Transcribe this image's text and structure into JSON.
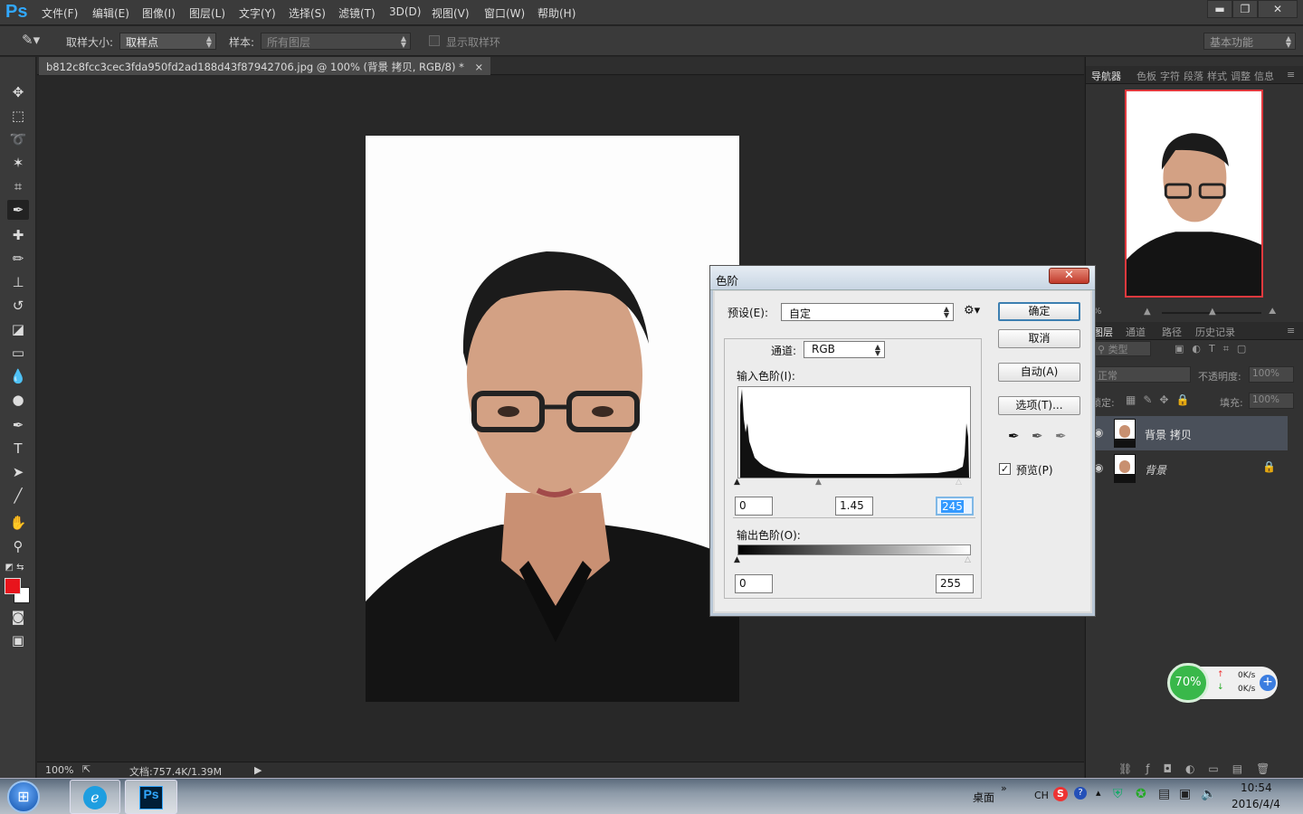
{
  "app": {
    "logo": "Ps"
  },
  "menu": [
    "文件(F)",
    "编辑(E)",
    "图像(I)",
    "图层(L)",
    "文字(Y)",
    "选择(S)",
    "滤镜(T)",
    "3D(D)",
    "视图(V)",
    "窗口(W)",
    "帮助(H)"
  ],
  "window_controls": {
    "minimize": "▬",
    "restore": "❐",
    "close": "✕"
  },
  "options_bar": {
    "sample_size_label": "取样大小:",
    "sample_size_value": "取样点",
    "sample_label": "样本:",
    "sample_value": "所有图层",
    "show_ring_label": "显示取样环",
    "workspace": "基本功能"
  },
  "document": {
    "tab_title": "b812c8fcc3cec3fda950fd2ad188d43f87942706.jpg @ 100% (背景 拷贝, RGB/8) *",
    "tab_close": "×"
  },
  "status": {
    "zoom": "100%",
    "doc_size": "文档:757.4K/1.39M"
  },
  "panels": {
    "top_tabs": [
      "导航器",
      "色板",
      "字符",
      "段落",
      "样式",
      "调整",
      "信息"
    ],
    "nav_zoom": "%",
    "layer_tabs": [
      "图层",
      "通道",
      "路径",
      "历史记录"
    ],
    "filter_type": "类型",
    "blend_mode": "正常",
    "opacity_label": "不透明度:",
    "opacity_value": "100%",
    "lock_label": "锁定:",
    "fill_label": "填充:",
    "fill_value": "100%",
    "layers": [
      {
        "name": "背景 拷贝",
        "selected": true
      },
      {
        "name": "背景",
        "locked": true
      }
    ]
  },
  "levels_dialog": {
    "title": "色阶",
    "close": "✕",
    "preset_label": "预设(E):",
    "preset_value": "自定",
    "channel_label": "通道:",
    "channel_value": "RGB",
    "input_levels_label": "输入色阶(I):",
    "input_black": "0",
    "input_gamma": "1.45",
    "input_white": "245",
    "output_levels_label": "输出色阶(O):",
    "output_black": "0",
    "output_white": "255",
    "ok": "确定",
    "cancel": "取消",
    "auto": "自动(A)",
    "options": "选项(T)...",
    "preview_label": "预览(P)",
    "preview_checked": true
  },
  "net_widget": {
    "cpu": "70%",
    "up": "0K/s",
    "down": "0K/s"
  },
  "taskbar": {
    "desktop_label": "桌面",
    "lang": "CH",
    "time": "10:54",
    "date": "2016/4/4",
    "ps_label": "Ps"
  },
  "colors": {
    "foreground": "#e8141c",
    "background": "#ffffff",
    "accent": "#31a8ff",
    "nav_border": "#e0393e"
  }
}
